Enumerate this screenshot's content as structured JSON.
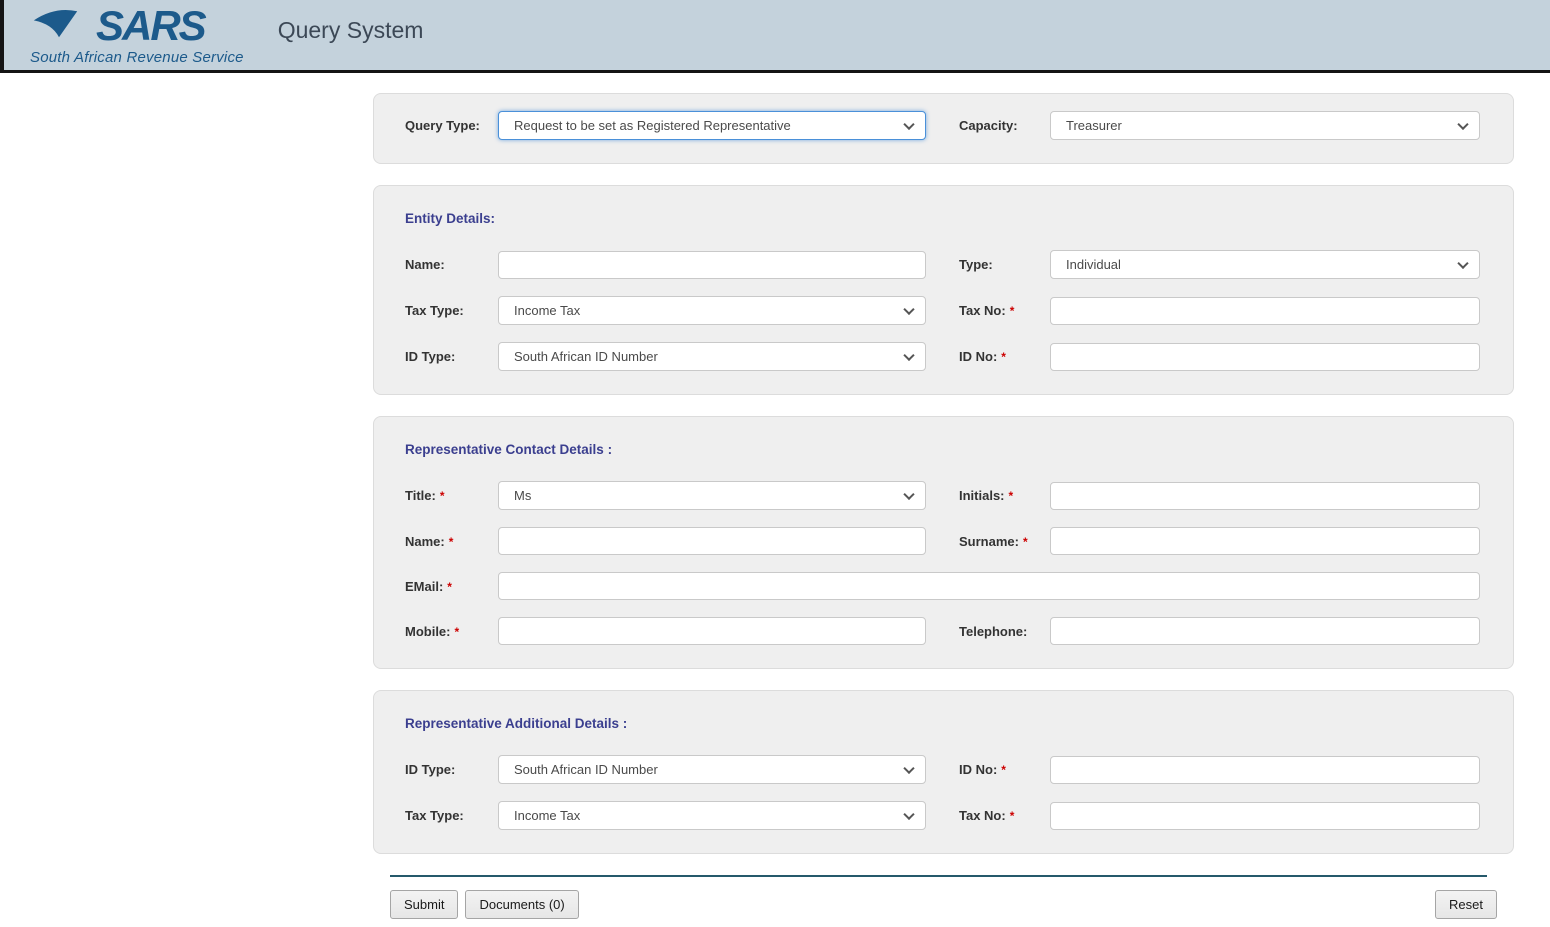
{
  "header": {
    "brand": "SARS",
    "tagline": "South African Revenue Service",
    "app_title": "Query System"
  },
  "query_panel": {
    "query_type": {
      "label": "Query Type:",
      "value": "Request to be set as Registered Representative"
    },
    "capacity": {
      "label": "Capacity:",
      "value": "Treasurer"
    }
  },
  "entity_details": {
    "heading": "Entity Details:",
    "name": {
      "label": "Name:"
    },
    "type": {
      "label": "Type:",
      "value": "Individual"
    },
    "tax_type": {
      "label": "Tax Type:",
      "value": "Income Tax"
    },
    "tax_no": {
      "label": "Tax No:",
      "required": "*"
    },
    "id_type": {
      "label": "ID Type:",
      "value": "South African ID Number"
    },
    "id_no": {
      "label": "ID No:",
      "required": "*"
    }
  },
  "representative_contact": {
    "heading": "Representative Contact Details :",
    "title": {
      "label": "Title:",
      "required": "*",
      "value": "Ms"
    },
    "initials": {
      "label": "Initials:",
      "required": "*"
    },
    "name": {
      "label": "Name:",
      "required": "*"
    },
    "surname": {
      "label": "Surname:",
      "required": "*"
    },
    "email": {
      "label": "EMail:",
      "required": "*"
    },
    "mobile": {
      "label": "Mobile:",
      "required": "*"
    },
    "telephone": {
      "label": "Telephone:"
    }
  },
  "representative_additional": {
    "heading": "Representative Additional Details :",
    "id_type": {
      "label": "ID Type:",
      "value": "South African ID Number"
    },
    "id_no": {
      "label": "ID No:",
      "required": "*"
    },
    "tax_type": {
      "label": "Tax Type:",
      "value": "Income Tax"
    },
    "tax_no": {
      "label": "Tax No:",
      "required": "*"
    }
  },
  "footer": {
    "submit": "Submit",
    "documents": "Documents (0)",
    "reset": "Reset"
  },
  "colors": {
    "header_bg": "#c4d2dc",
    "brand_blue": "#1c5a8b",
    "panel_bg": "#efefef",
    "section_heading": "#3b3f8f",
    "required_red": "#cc0000",
    "focus_blue": "#4a90d9",
    "divider_teal": "#25596b"
  }
}
